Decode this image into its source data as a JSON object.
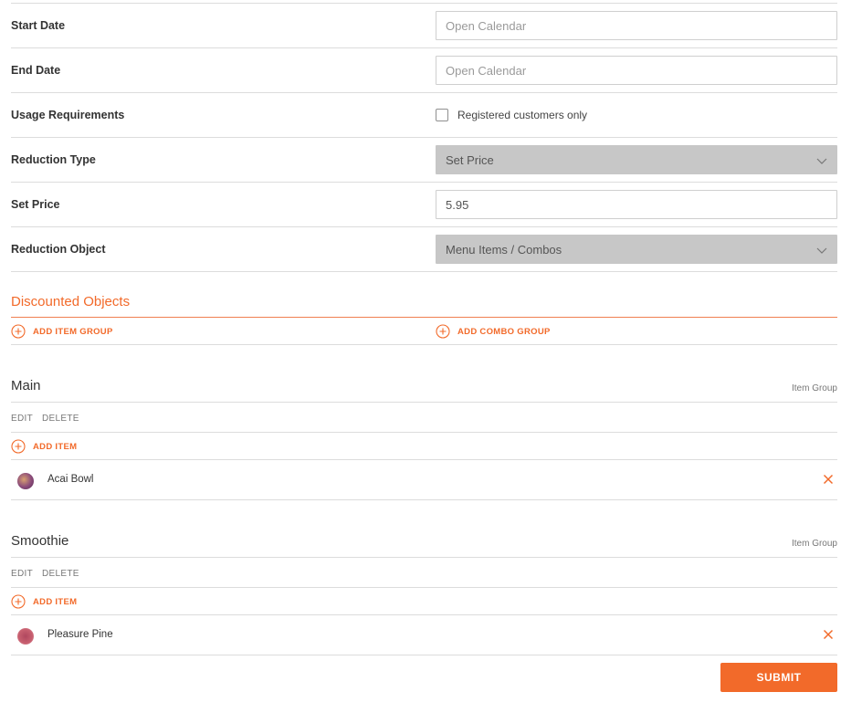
{
  "form": {
    "start_date": {
      "label": "Start Date",
      "placeholder": "Open Calendar"
    },
    "end_date": {
      "label": "End Date",
      "placeholder": "Open Calendar"
    },
    "usage": {
      "label": "Usage Requirements",
      "checkbox_label": "Registered customers only",
      "checked": false
    },
    "reduction_type": {
      "label": "Reduction Type",
      "value": "Set Price"
    },
    "set_price": {
      "label": "Set Price",
      "value": "5.95"
    },
    "reduction_object": {
      "label": "Reduction Object",
      "value": "Menu Items / Combos"
    }
  },
  "discounted": {
    "title": "Discounted Objects",
    "add_item_group": "ADD ITEM GROUP",
    "add_combo_group": "ADD COMBO GROUP"
  },
  "groups": [
    {
      "name": "Main",
      "type": "Item Group",
      "edit": "EDIT",
      "delete": "DELETE",
      "add_item": "ADD ITEM",
      "items": [
        {
          "name": "Acai Bowl",
          "thumb_color": "#8a4a7a"
        }
      ]
    },
    {
      "name": "Smoothie",
      "type": "Item Group",
      "edit": "EDIT",
      "delete": "DELETE",
      "add_item": "ADD ITEM",
      "items": [
        {
          "name": "Pleasure Pine",
          "thumb_color": "#b0475e"
        }
      ]
    }
  ],
  "submit_label": "SUBMIT",
  "colors": {
    "accent": "#f26a2a",
    "select_bg": "#c7c7c7",
    "divider": "#dcdcdc"
  }
}
